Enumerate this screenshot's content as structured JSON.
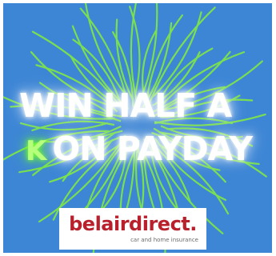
{
  "banner": {
    "headline_line1": "WIN HALF A",
    "headline_k": "K",
    "headline_line2": "ON PAYDAY",
    "background_color": "#3d86d6",
    "firework_color": "#7de34a"
  },
  "logo": {
    "name": "belairdirect.",
    "tagline": "car and home insurance"
  }
}
